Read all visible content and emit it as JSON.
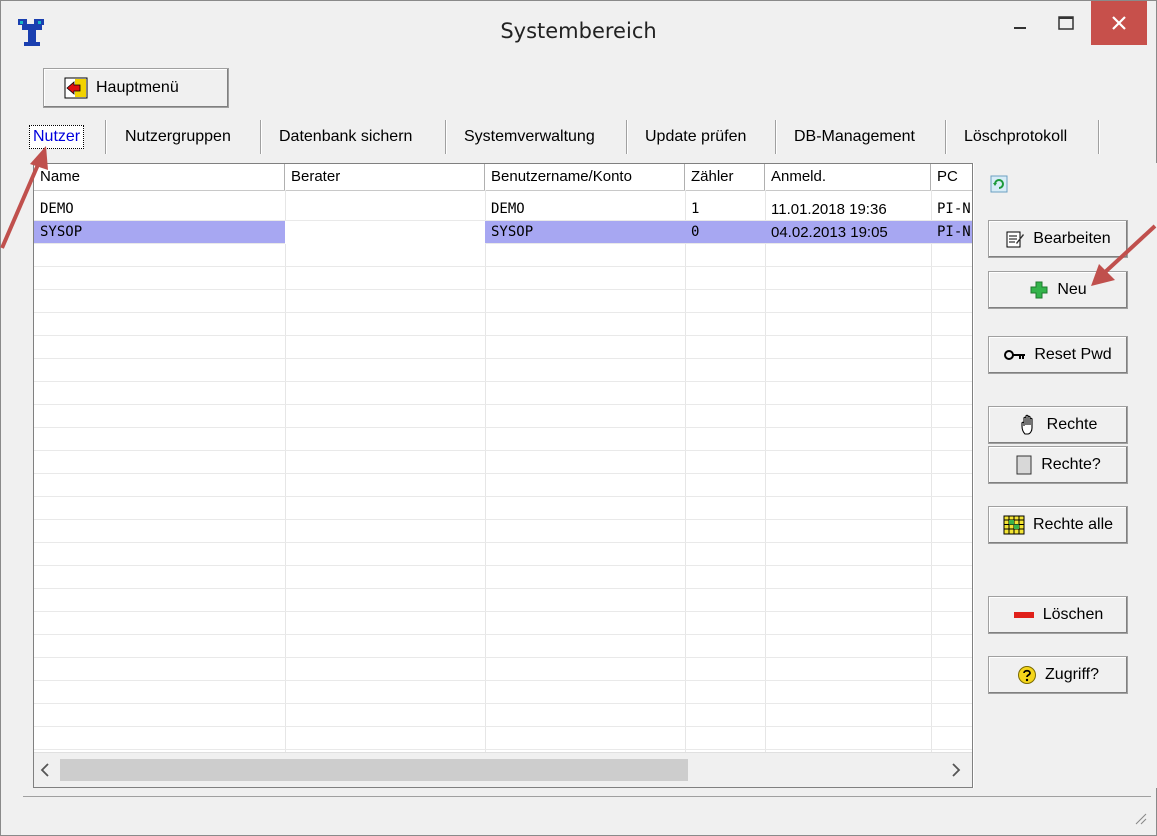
{
  "window": {
    "title": "Systembereich"
  },
  "toolbar": {
    "hauptmenu_label": "Hauptmenü"
  },
  "tabs": [
    {
      "label": "Nutzer",
      "active": true
    },
    {
      "label": "Nutzergruppen"
    },
    {
      "label": "Datenbank sichern"
    },
    {
      "label": "Systemverwaltung"
    },
    {
      "label": "Update prüfen"
    },
    {
      "label": "DB-Management"
    },
    {
      "label": "Löschprotokoll"
    }
  ],
  "grid": {
    "columns": [
      "Name",
      "Berater",
      "Benutzername/Konto",
      "Zähler",
      "Anmeld.",
      "PC"
    ],
    "rows": [
      {
        "name": "DEMO",
        "berater": "",
        "konto": "DEMO",
        "zaehler": "1",
        "anmeld": "11.01.2018 19:36",
        "pc": "PI-N",
        "selected": false
      },
      {
        "name": "SYSOP",
        "berater": "",
        "konto": "SYSOP",
        "zaehler": "0",
        "anmeld": "04.02.2013 19:05",
        "pc": "PI-N",
        "selected": true
      }
    ]
  },
  "side_buttons": {
    "bearbeiten": "Bearbeiten",
    "neu": "Neu",
    "reset_pwd": "Reset Pwd",
    "rechte": "Rechte",
    "rechte_q": "Rechte?",
    "rechte_alle": "Rechte alle",
    "loeschen": "Löschen",
    "zugriff": "Zugriff?"
  },
  "colors": {
    "selection": "#a7a7f2",
    "close_button": "#c7504b",
    "arrow": "#c0504d",
    "active_tab_text": "#0000dd"
  }
}
